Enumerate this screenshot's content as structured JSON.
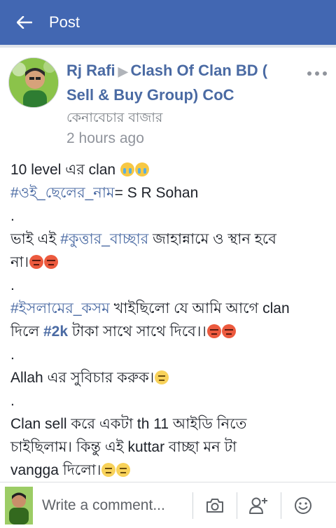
{
  "app_bar": {
    "back_icon": "arrow-left-icon",
    "title": "Post",
    "color": "#4267b2"
  },
  "post": {
    "author": "Rj Rafi",
    "group": "Clash Of Clan BD ( Sell & Buy Group) CoC",
    "subgroup": "কেনাবেচার বাজার",
    "time": "2 hours ago",
    "menu_icon": "more-dots-icon",
    "lines": {
      "l1_text": "10 level এর clan",
      "l2_tag": "#ওই_ছেলের_নাম",
      "l2_text": "= S R Sohan",
      "l3": ".",
      "l4_text_a": "ভাই এই ",
      "l4_tag": "#কুত্তার_বাচ্ছার",
      "l4_text_b": " জাহান্নামে ও স্থান হবে",
      "l5_text": "না।",
      "l6": ".",
      "l7_tag": "#ইসলামের_কসম",
      "l7_text": " খাইছিলো যে আমি আগে clan",
      "l8_text_a": "দিলে ",
      "l8_tag": "#2k",
      "l8_text_b": " টাকা সাথে সাথে দিবে।।",
      "l9": ".",
      "l10_text": "Allah এর সুবিচার করুক।",
      "l11": ".",
      "l12_text": "Clan  sell করে একটা th 11 আইডি নিতে",
      "l13_text": "চাইছিলাম। কিন্তু এই kuttar বাচ্ছা  মন টা",
      "l14_text": "vangga  দিলো।"
    }
  },
  "composer": {
    "placeholder": "Write a comment...",
    "camera_icon": "camera-icon",
    "tag_icon": "add-friend-icon",
    "emoji_icon": "smiley-icon"
  }
}
